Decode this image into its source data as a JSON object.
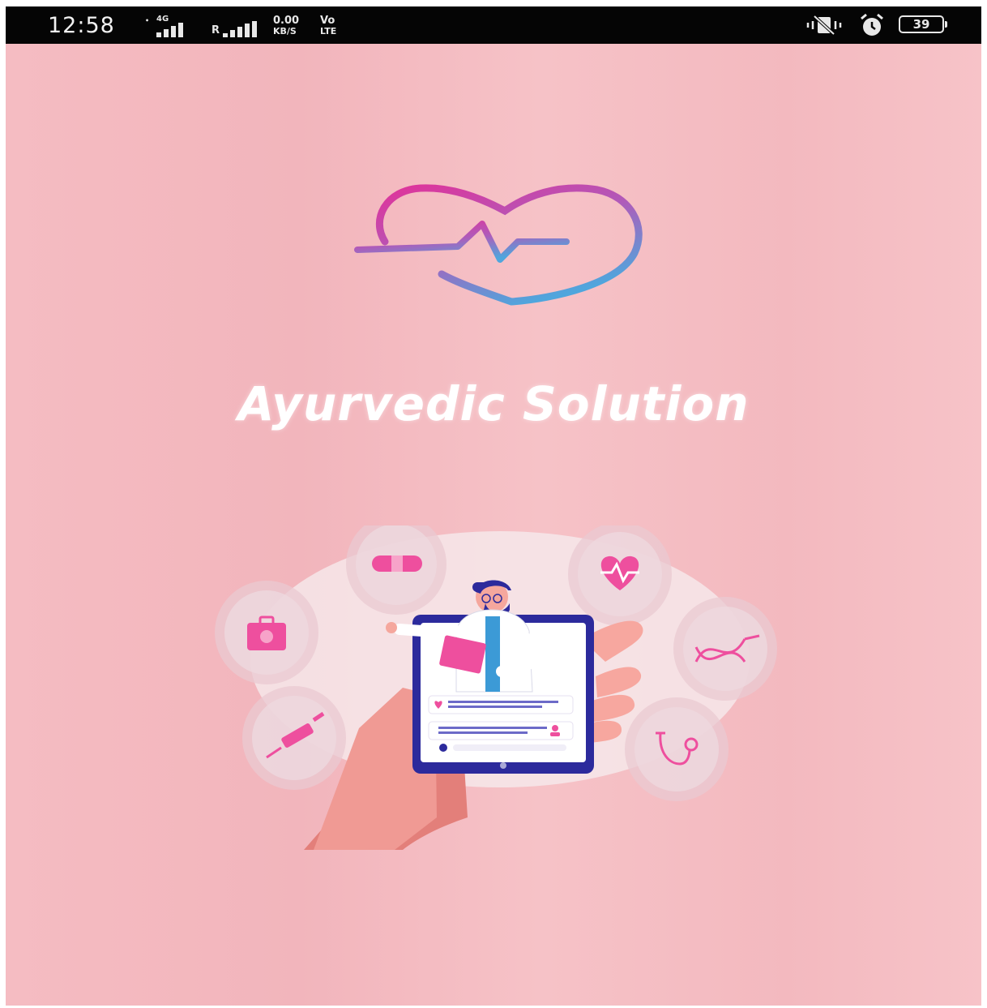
{
  "status_bar": {
    "time": "12:58",
    "network_4g": "4G",
    "roaming": "R",
    "speed_value": "0.00",
    "speed_unit": "KB/S",
    "volte_top": "Vo",
    "volte_bottom": "LTE",
    "battery": "39"
  },
  "splash": {
    "app_title": "Ayurvedic Solution"
  },
  "colors": {
    "background": "#f4bcc2",
    "heart_gradient_start": "#e0339a",
    "heart_gradient_end": "#4fa6dd",
    "accent_pink": "#ee4f9e",
    "doctor_coat": "#ffffff",
    "phone_frame": "#2c2a9c"
  },
  "icons": {
    "logo": "heart-pulse-icon",
    "bandage": "bandage-icon",
    "heart_monitor": "heart-rate-icon",
    "first_aid": "first-aid-kit-icon",
    "dna": "dna-icon",
    "syringe": "syringe-icon",
    "stethoscope": "stethoscope-icon"
  }
}
